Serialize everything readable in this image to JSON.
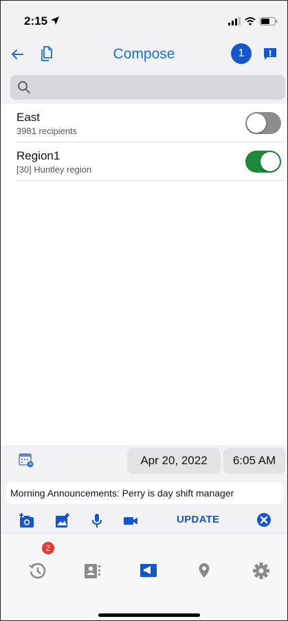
{
  "status_bar": {
    "time": "2:15"
  },
  "header": {
    "title": "Compose",
    "recipient_count": "1"
  },
  "search": {
    "placeholder": ""
  },
  "groups": [
    {
      "name": "East",
      "detail": "3981 recipients",
      "enabled": false
    },
    {
      "name": "Region1",
      "detail": "[30] Huntley region",
      "enabled": true
    }
  ],
  "schedule": {
    "date": "Apr 20, 2022",
    "time": "6:05 AM"
  },
  "message": {
    "text": "Morning Announcements: Perry is day shift manager"
  },
  "toolbar": {
    "update_label": "UPDATE"
  },
  "tabbar": {
    "history_badge": "2",
    "active_tab": "compose"
  },
  "colors": {
    "accent": "#1a6fd8",
    "badge_blue": "#1756c9",
    "toggle_on": "#1f8a3b",
    "toggle_off": "#8c8c8e",
    "notification_red": "#e53935"
  },
  "icons": {
    "back": "arrow-left-icon",
    "copy": "copy-icon",
    "message": "chat-alert-icon",
    "search": "search-icon",
    "calendar": "calendar-icon",
    "camera": "camera-add-icon",
    "image": "image-add-icon",
    "mic": "microphone-icon",
    "video": "video-camera-icon",
    "clear": "close-circle-icon",
    "history": "history-icon",
    "contacts": "contacts-icon",
    "compose": "megaphone-icon",
    "location": "location-pin-icon",
    "settings": "gear-icon"
  }
}
